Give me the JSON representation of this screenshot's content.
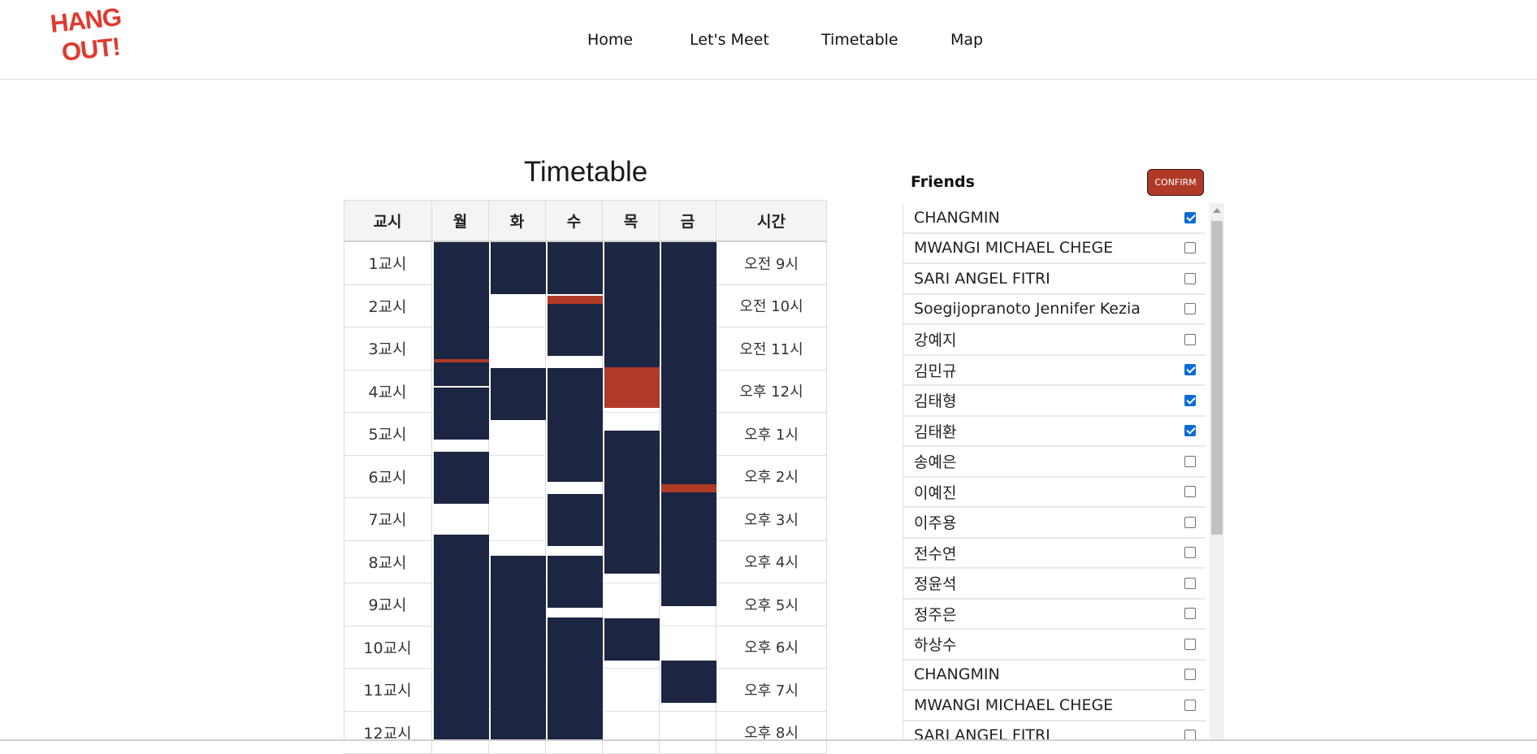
{
  "logo": {
    "line1": "HANG",
    "line2": "OUT!"
  },
  "nav": [
    {
      "label": "Home"
    },
    {
      "label": "Let's Meet"
    },
    {
      "label": "Timetable"
    },
    {
      "label": "Map"
    }
  ],
  "timetable": {
    "title": "Timetable",
    "headers": [
      "교시",
      "월",
      "화",
      "수",
      "목",
      "금",
      "시간"
    ],
    "periods": [
      "1교시",
      "2교시",
      "3교시",
      "4교시",
      "5교시",
      "6교시",
      "7교시",
      "8교시",
      "9교시",
      "10교시",
      "11교시",
      "12교시"
    ],
    "times": [
      "오전 9시",
      "오전 10시",
      "오전 11시",
      "오후 12시",
      "오후 1시",
      "오후 2시",
      "오후 3시",
      "오후 4시",
      "오후 5시",
      "오후 6시",
      "오후 7시",
      "오후 8시"
    ]
  },
  "friends": {
    "title": "Friends",
    "confirm_label": "CONFIRM",
    "items": [
      {
        "name": "CHANGMIN",
        "checked": true
      },
      {
        "name": "MWANGI MICHAEL CHEGE",
        "checked": false
      },
      {
        "name": "SARI ANGEL FITRI",
        "checked": false
      },
      {
        "name": "Soegijopranoto Jennifer Kezia",
        "checked": false
      },
      {
        "name": "강예지",
        "checked": false
      },
      {
        "name": "김민규",
        "checked": true
      },
      {
        "name": "김태형",
        "checked": true
      },
      {
        "name": "김태환",
        "checked": true
      },
      {
        "name": "송예은",
        "checked": false
      },
      {
        "name": "이예진",
        "checked": false
      },
      {
        "name": "이주용",
        "checked": false
      },
      {
        "name": "전수연",
        "checked": false
      },
      {
        "name": "정윤석",
        "checked": false
      },
      {
        "name": "정주은",
        "checked": false
      },
      {
        "name": "하상수",
        "checked": false
      },
      {
        "name": "CHANGMIN",
        "checked": false
      },
      {
        "name": "MWANGI MICHAEL CHEGE",
        "checked": false
      },
      {
        "name": "SARI ANGEL FITRI",
        "checked": false
      }
    ]
  },
  "colors": {
    "busy": "#1c2541",
    "overlap": "#b03a28",
    "brand": "#e03a2f",
    "checkbox_on": "#0b6cd6"
  }
}
